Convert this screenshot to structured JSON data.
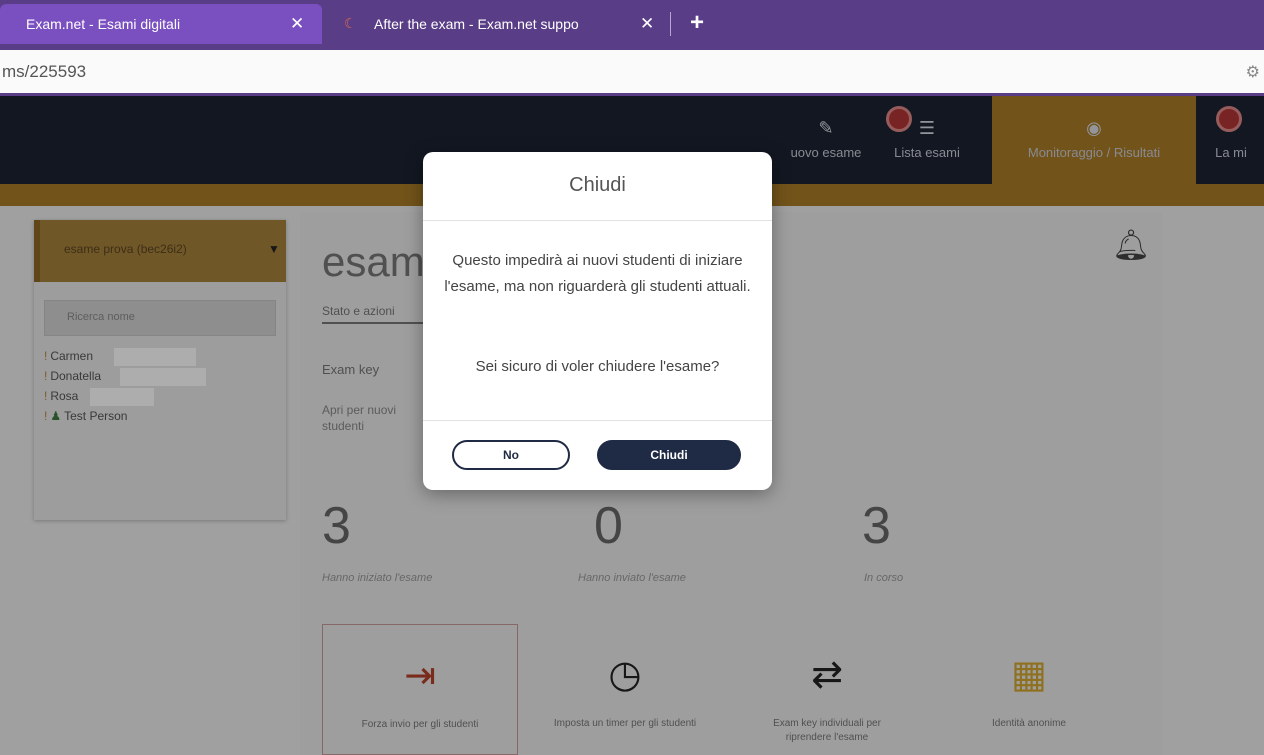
{
  "browser": {
    "tabs": [
      {
        "title": "Exam.net - Esami digitali",
        "active": true
      },
      {
        "title": "After the exam - Exam.net suppo",
        "active": false
      }
    ],
    "url": "ms/225593"
  },
  "nav": {
    "items": [
      {
        "label": "uovo esame"
      },
      {
        "label": "Lista esami"
      },
      {
        "label": "Monitoraggio / Risultati"
      },
      {
        "label": "La mi"
      }
    ]
  },
  "sidebar": {
    "exam_select": "esame prova (bec26i2)",
    "search_placeholder": "Ricerca nome",
    "students": [
      {
        "name": "Carmen"
      },
      {
        "name": "Donatella"
      },
      {
        "name": "Rosa"
      },
      {
        "name": "Test Person"
      }
    ]
  },
  "main": {
    "title": "esame",
    "subtab": "Stato e azioni",
    "exam_key_label": "Exam key",
    "open_text": "Apri per nuovi studenti",
    "stats": [
      {
        "value": "3",
        "label": "Hanno iniziato l'esame"
      },
      {
        "value": "0",
        "label": "Hanno inviato l'esame"
      },
      {
        "value": "3",
        "label": "In corso"
      }
    ],
    "actions": [
      {
        "label": "Forza invio per gli studenti"
      },
      {
        "label": "Imposta un timer per gli studenti"
      },
      {
        "label": "Exam key individuali per riprendere l'esame"
      },
      {
        "label": "Identità anonime"
      }
    ]
  },
  "modal": {
    "title": "Chiudi",
    "message": "Questo impedirà ai nuovi studenti di iniziare l'esame, ma non riguarderà gli studenti attuali.",
    "question": "Sei sicuro di voler chiudere l'esame?",
    "cancel_label": "No",
    "confirm_label": "Chiudi"
  },
  "colors": {
    "tabbar": "#5a3d87",
    "header": "#1b2232",
    "accent": "#a97b27",
    "primary_button": "#1f2a44",
    "danger": "#b13636"
  }
}
